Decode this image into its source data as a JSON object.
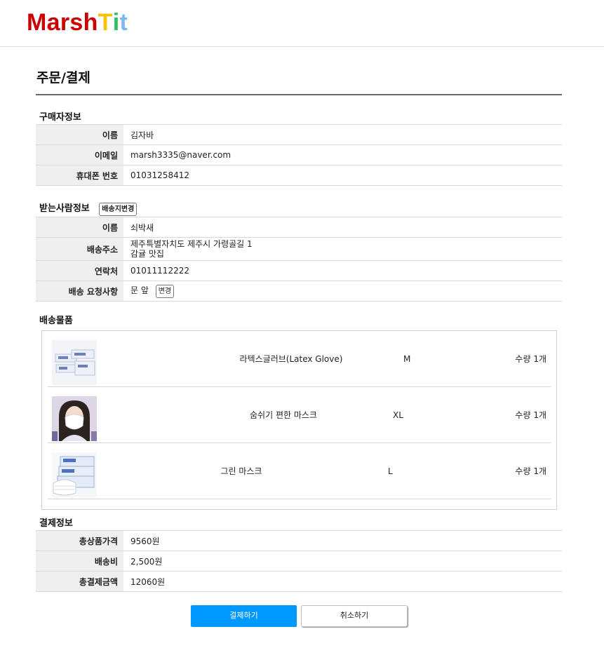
{
  "header": {
    "logo": [
      {
        "text": "Marsh",
        "color": "#cc0000"
      },
      {
        "text": "T",
        "color": "#f5c400"
      },
      {
        "text": "i",
        "color": "#2dbe60"
      },
      {
        "text": "t",
        "color": "#7fb8f0"
      }
    ]
  },
  "page": {
    "title": "주문/결제"
  },
  "buyer": {
    "section_title": "구매자정보",
    "rows": [
      {
        "label": "이름",
        "value": "김자바"
      },
      {
        "label": "이메일",
        "value": "marsh3335@naver.com"
      },
      {
        "label": "휴대폰 번호",
        "value": "01031258412"
      }
    ]
  },
  "recipient": {
    "section_title": "받는사람정보",
    "change_address_label": "배송지변경",
    "name_label": "이름",
    "name_value": "쇠박새",
    "address_label": "배송주소",
    "address_line1": "제주특별자치도 제주시 가령골길 1",
    "address_line2": "감귤 맛집",
    "phone_label": "연락처",
    "phone_value": "01011112222",
    "request_label": "배송 요청사항",
    "request_value": "문 앞",
    "request_change_label": "변경"
  },
  "items": {
    "section_title": "배송물품",
    "list": [
      {
        "name": "라텍스글러브(Latex Glove)",
        "size": "M",
        "qty": "수량 1개",
        "thumb_icon": "latex-glove-box-icon"
      },
      {
        "name": "숨쉬기 편한 마스크",
        "size": "XL",
        "qty": "수량 1개",
        "thumb_icon": "mask-model-icon"
      },
      {
        "name": "그린 마스크",
        "size": "L",
        "qty": "수량 1개",
        "thumb_icon": "mask-box-icon"
      }
    ]
  },
  "payment": {
    "section_title": "결제정보",
    "rows": [
      {
        "label": "총상품가격",
        "value": "9560원"
      },
      {
        "label": "배송비",
        "value": "2,500원"
      },
      {
        "label": "총결제금액",
        "value": "12060원"
      }
    ]
  },
  "actions": {
    "pay_label": "결제하기",
    "cancel_label": "취소하기",
    "pay_color": "#0099ff"
  }
}
